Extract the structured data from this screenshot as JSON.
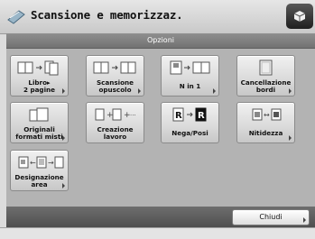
{
  "window": {
    "title": "Scansione e memorizzaz."
  },
  "panel": {
    "header": "Opzioni"
  },
  "options": [
    {
      "label": "Libro▸\n2 pagine",
      "icon": "book-to-two-pages-icon"
    },
    {
      "label": "Scansione\nopuscolo",
      "icon": "booklet-scan-icon"
    },
    {
      "label": "N in 1",
      "icon": "n-in-1-icon"
    },
    {
      "label": "Cancellazione\nbordi",
      "icon": "border-erase-icon"
    },
    {
      "label": "Originali\nformati misti",
      "icon": "mixed-originals-icon"
    },
    {
      "label": "Creazione\nlavoro",
      "icon": "job-build-icon"
    },
    {
      "label": "Nega/Posi",
      "icon": "nega-posi-icon"
    },
    {
      "label": "Nitidezza",
      "icon": "sharpness-icon"
    },
    {
      "label": "Designazione\narea",
      "icon": "area-designation-icon"
    }
  ],
  "footer": {
    "close_label": "Chiudi"
  }
}
